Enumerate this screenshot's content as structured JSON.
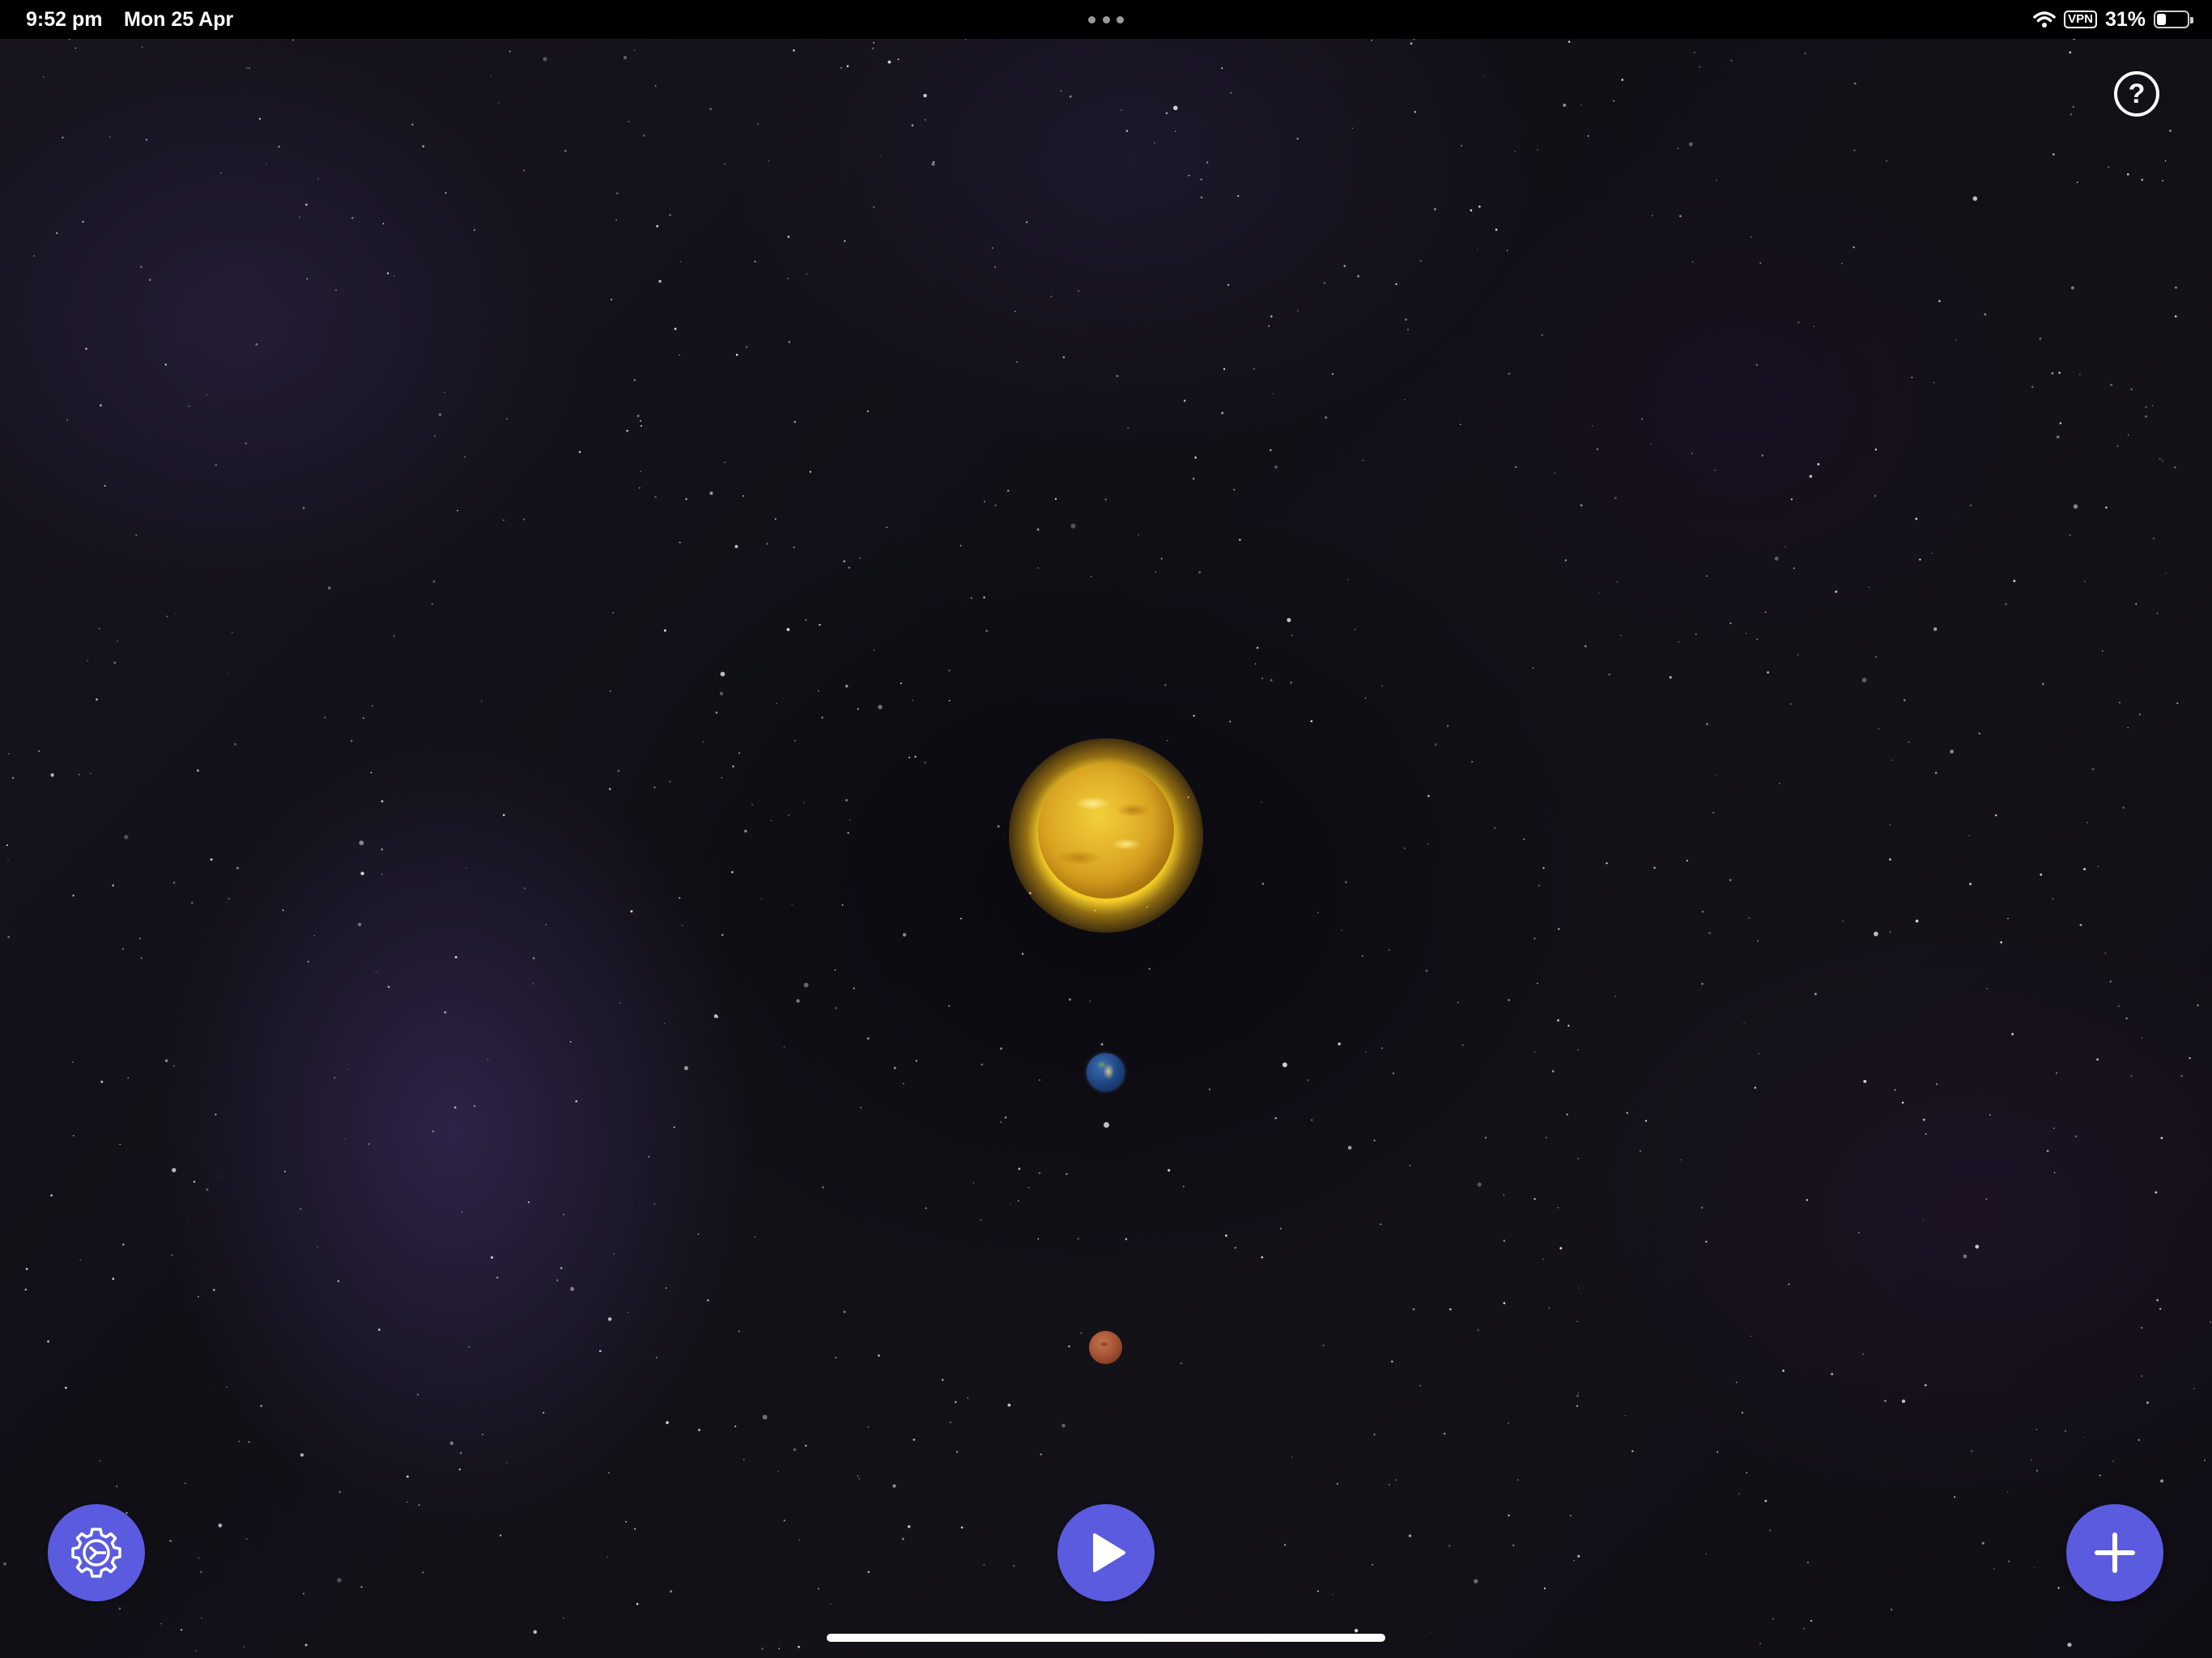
{
  "status_bar": {
    "time": "9:52 pm",
    "date": "Mon 25 Apr",
    "vpn": "VPN",
    "battery": "31%",
    "battery_level": 0.31
  },
  "help": {
    "label": "?",
    "icon": "question-circle-icon"
  },
  "scene": {
    "bodies": [
      "sun",
      "earth",
      "moon",
      "mars"
    ]
  },
  "controls": {
    "settings_icon": "gear-icon",
    "play_icon": "play-icon",
    "add_icon": "plus-icon"
  },
  "colors": {
    "accent": "#5b5be0",
    "status_bar_bg": "#000000",
    "sun": "#e0b22a"
  }
}
